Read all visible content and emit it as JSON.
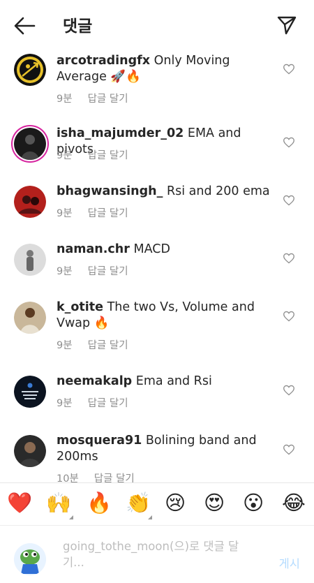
{
  "header": {
    "back_icon": "arrow-left-icon",
    "title": "댓글",
    "send_icon": "paper-plane-icon"
  },
  "comments": [
    {
      "username": "arcotradingfx",
      "text": "Only Moving Average 🚀🔥",
      "time": "9분",
      "reply": "답글 달기"
    },
    {
      "username": "isha_majumder_02",
      "text": "EMA and pivots",
      "time": "9분",
      "reply": "답글 달기"
    },
    {
      "username": "bhagwansingh_",
      "text": "Rsi and 200 ema",
      "time": "9분",
      "reply": "답글 달기"
    },
    {
      "username": "naman.chr",
      "text": "MACD",
      "time": "9분",
      "reply": "답글 달기"
    },
    {
      "username": "k_otite",
      "text": "The two Vs, Volume and Vwap 🔥",
      "time": "9분",
      "reply": "답글 달기"
    },
    {
      "username": "neemakalp",
      "text": "Ema and Rsi",
      "time": "9분",
      "reply": "답글 달기"
    },
    {
      "username": "mosquera91",
      "text": "Bolining band and 200ms",
      "time": "10분",
      "reply": "답글 달기"
    }
  ],
  "reactions": [
    "❤️",
    "🙌",
    "🔥",
    "👏",
    "😢",
    "😍",
    "😮",
    "😂"
  ],
  "compose": {
    "placeholder": "going_tothe_moon(으)로 댓글 달기...",
    "post_label": "게시"
  },
  "colors": {
    "accent": "#0095f6",
    "post_disabled": "#b3dbff",
    "meta_text": "#8e8e8e",
    "story_ring": "#d6249f"
  }
}
